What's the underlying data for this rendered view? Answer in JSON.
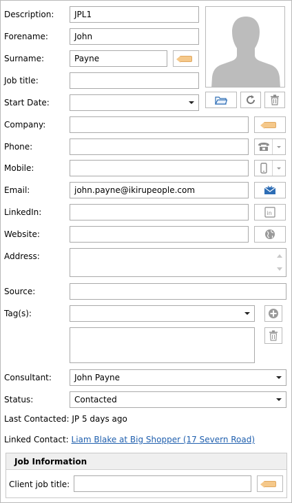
{
  "labels": {
    "description": "Description:",
    "forename": "Forename:",
    "surname": "Surname:",
    "job_title": "Job title:",
    "start_date": "Start Date:",
    "company": "Company:",
    "phone": "Phone:",
    "mobile": "Mobile:",
    "email": "Email:",
    "linkedin": "LinkedIn:",
    "website": "Website:",
    "address": "Address:",
    "source": "Source:",
    "tags": "Tag(s):",
    "consultant": "Consultant:",
    "status": "Status:",
    "last_contacted": "Last Contacted:",
    "linked_contact": "Linked Contact:"
  },
  "values": {
    "description": "JPL1",
    "forename": "John",
    "surname": "Payne",
    "job_title": "",
    "start_date": "",
    "company": "",
    "phone": "",
    "mobile": "",
    "email": "john.payne@ikirupeople.com",
    "linkedin": "",
    "website": "",
    "address": "",
    "source": "",
    "tags": "",
    "consultant": "John Payne",
    "status": "Contacted",
    "last_contacted": "JP 5 days ago",
    "linked_contact": "Liam Blake at Big Shopper (17 Severn Road)"
  },
  "job_information": {
    "title": "Job Information",
    "client_job_title_label": "Client job title:",
    "client_job_title_value": ""
  },
  "icons": {
    "avatar": "person-silhouette",
    "tag": "tag-icon",
    "browse": "folder-icon",
    "refresh": "refresh-icon",
    "delete": "trash-icon",
    "phone": "telephone-icon",
    "mobile": "mobile-phone-icon",
    "email": "envelope-icon",
    "linkedin": "linkedin-icon",
    "website": "globe-icon",
    "add": "plus-circle-icon"
  },
  "colors": {
    "tag_fill": "#f5c88a",
    "link": "#1f5fae",
    "email_icon": "#2d6db5"
  }
}
